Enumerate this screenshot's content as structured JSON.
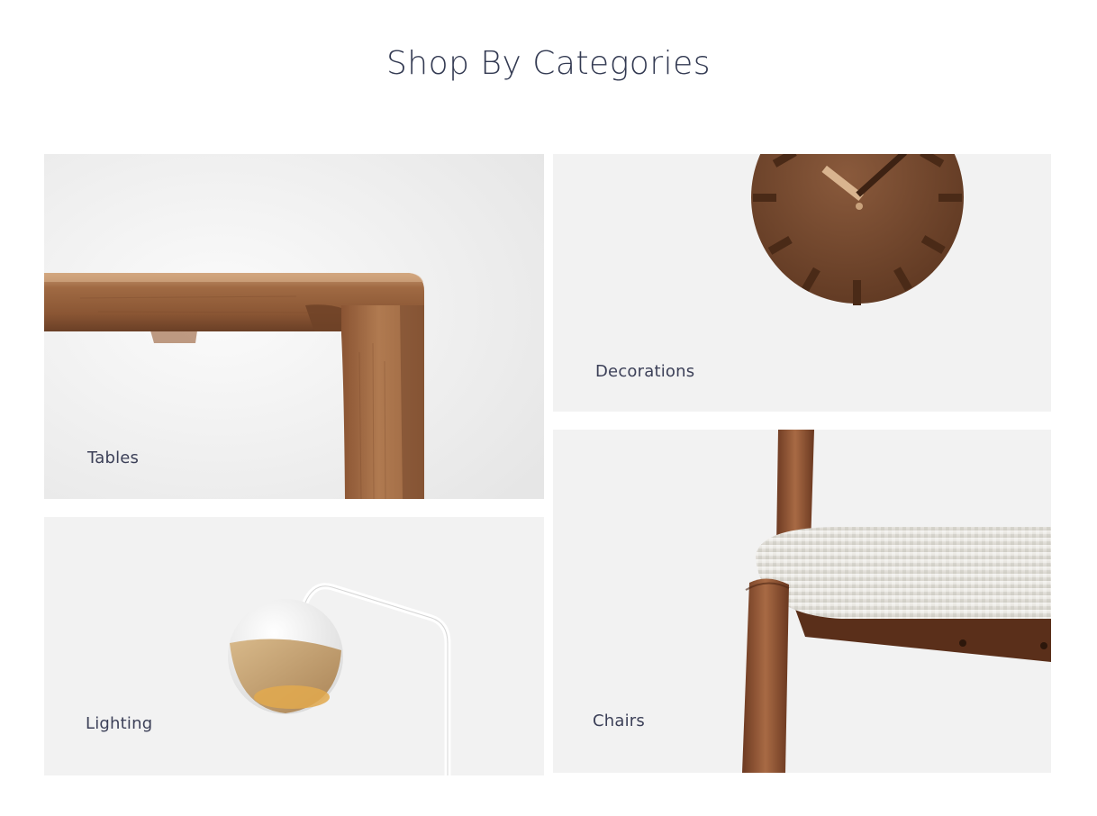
{
  "section": {
    "title": "Shop By Categories"
  },
  "categories": [
    {
      "label": "Tables",
      "image": "wooden-table-corner"
    },
    {
      "label": "Decorations",
      "image": "walnut-wall-clock"
    },
    {
      "label": "Lighting",
      "image": "white-globe-floor-lamp"
    },
    {
      "label": "Chairs",
      "image": "upholstered-walnut-chair"
    }
  ],
  "colors": {
    "title": "#333a52",
    "label": "#3c4058",
    "tile_background": "#f2f2f2",
    "walnut": "#7a4a30"
  }
}
